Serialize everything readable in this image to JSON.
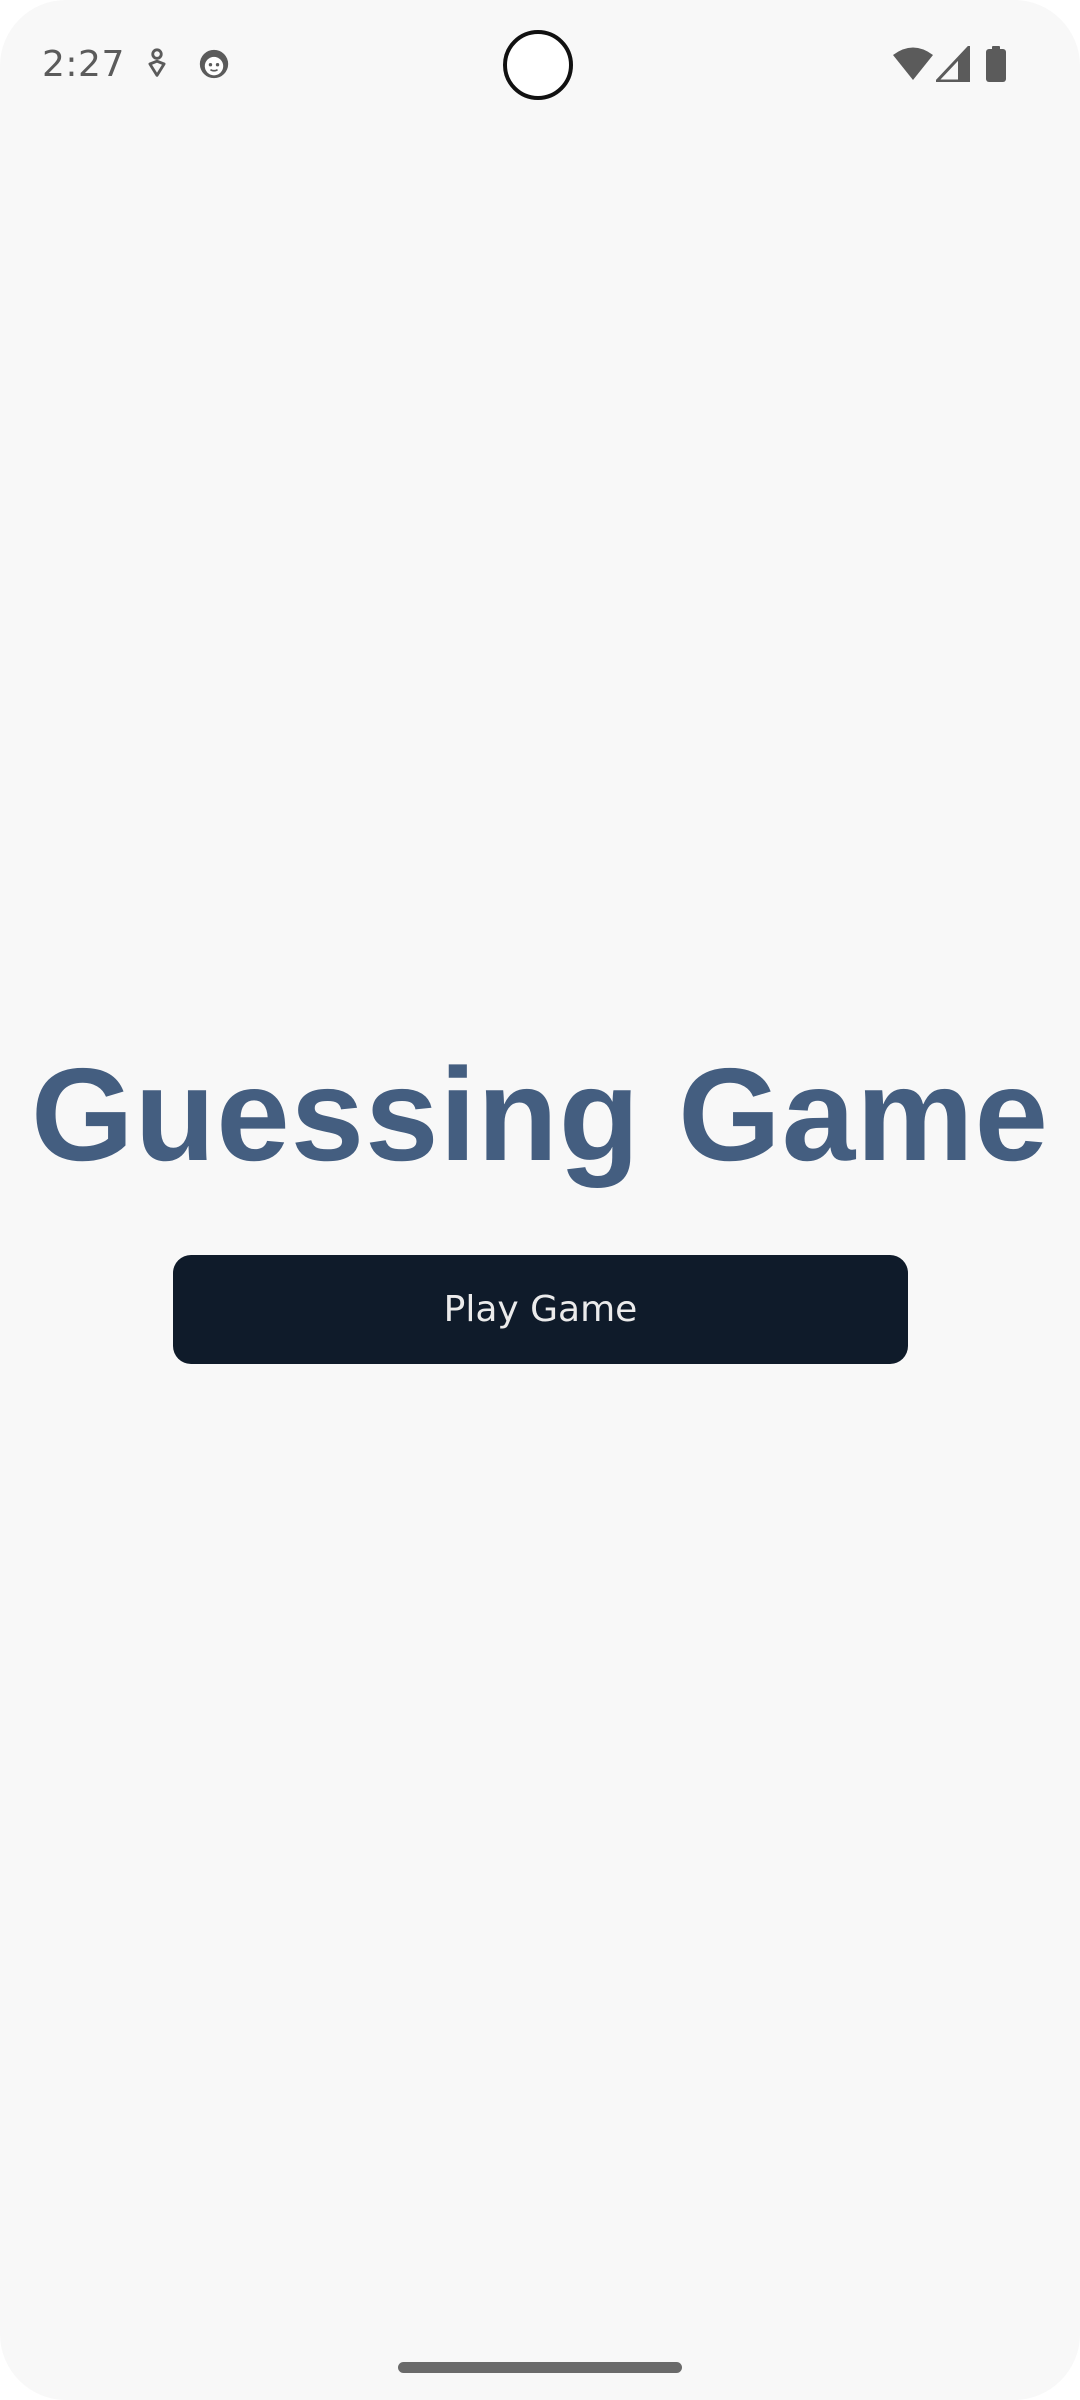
{
  "status_bar": {
    "time": "2:27",
    "left_icons": [
      "accessibility-icon",
      "face-icon"
    ],
    "right_icons": [
      "wifi-icon",
      "cell-signal-icon",
      "battery-icon"
    ]
  },
  "main": {
    "title": "Guessing Game",
    "play_button_label": "Play Game"
  },
  "colors": {
    "background": "#f8f8f8",
    "title": "#445e80",
    "button_bg": "#0f1b2a",
    "button_text": "#ebebeb"
  }
}
